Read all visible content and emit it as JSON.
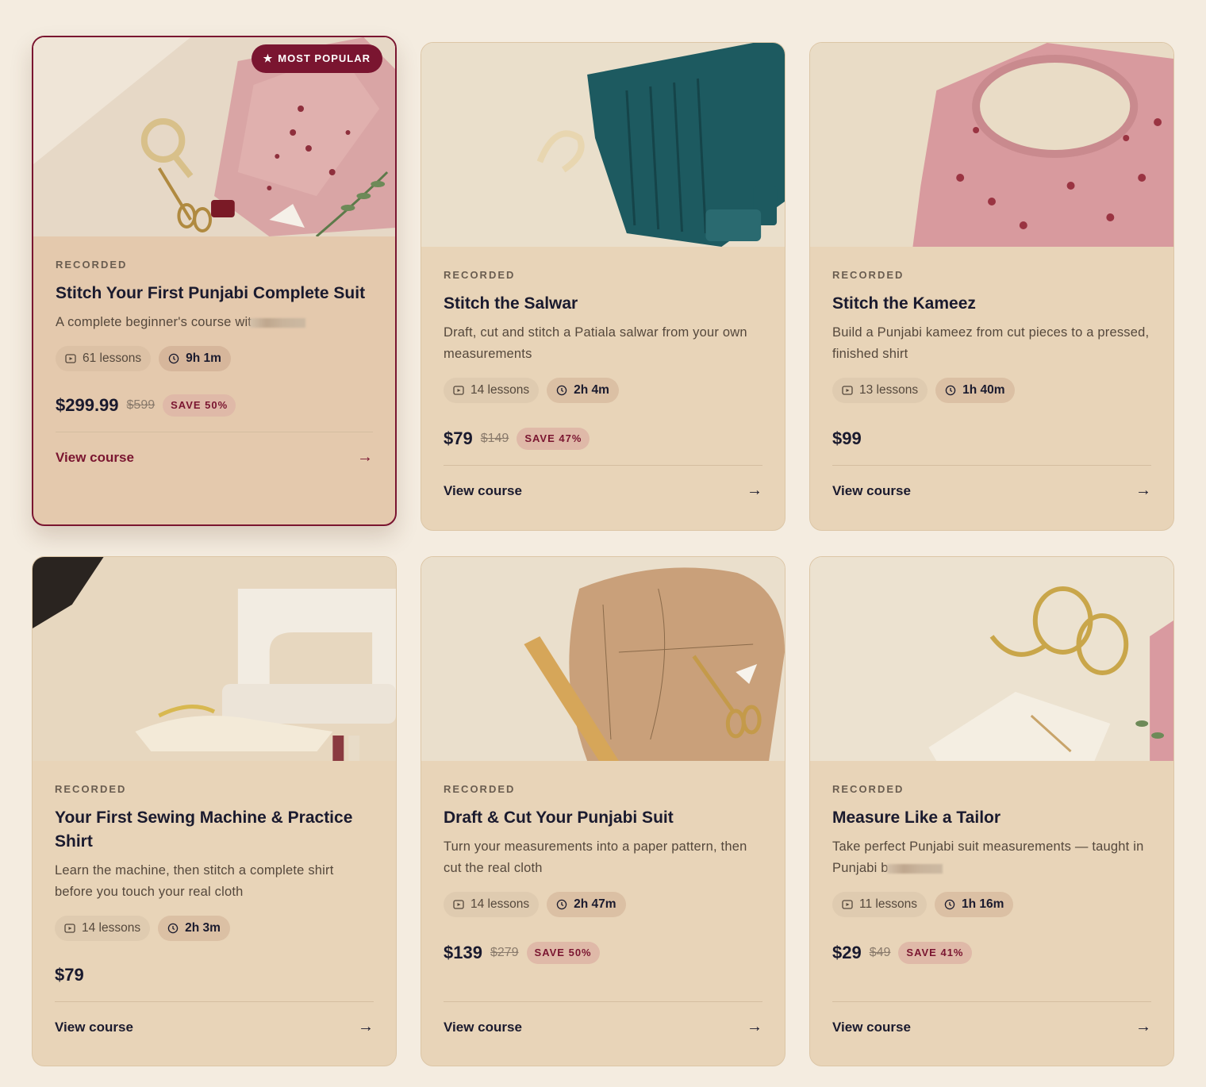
{
  "popular_badge": "MOST POPULAR",
  "colors": {
    "accent": "#7a1530",
    "card_bg": "#e8d4b8",
    "page_bg": "#f4ece0"
  },
  "courses": [
    {
      "kicker": "RECORDED",
      "title": "Stitch Your First Punjabi Complete Suit",
      "description": "A complete beginner's course wit",
      "lessons": "61 lessons",
      "duration": "9h 1m",
      "price": "$299.99",
      "original_price": "$599",
      "save": "SAVE 50%",
      "cta": "View course",
      "arrow": "→"
    },
    {
      "kicker": "RECORDED",
      "title": "Stitch the Salwar",
      "description": "Draft, cut and stitch a Patiala salwar from your own measurements",
      "lessons": "14 lessons",
      "duration": "2h 4m",
      "price": "$79",
      "original_price": "$149",
      "save": "SAVE 47%",
      "cta": "View course",
      "arrow": "→"
    },
    {
      "kicker": "RECORDED",
      "title": "Stitch the Kameez",
      "description": "Build a Punjabi kameez from cut pieces to a pressed, finished shirt",
      "lessons": "13 lessons",
      "duration": "1h 40m",
      "price": "$99",
      "cta": "View course",
      "arrow": "→"
    },
    {
      "kicker": "RECORDED",
      "title": "Your First Sewing Machine & Practice Shirt",
      "description": "Learn the machine, then stitch a complete shirt before you touch your real cloth",
      "lessons": "14 lessons",
      "duration": "2h 3m",
      "price": "$79",
      "cta": "View course",
      "arrow": "→"
    },
    {
      "kicker": "RECORDED",
      "title": "Draft & Cut Your Punjabi Suit",
      "description": "Turn your measurements into a paper pattern, then cut the real cloth",
      "lessons": "14 lessons",
      "duration": "2h 47m",
      "price": "$139",
      "original_price": "$279",
      "save": "SAVE 50%",
      "cta": "View course",
      "arrow": "→"
    },
    {
      "kicker": "RECORDED",
      "title": "Measure Like a Tailor",
      "description": "Take perfect Punjabi suit measurements — taught in Punjabi b",
      "lessons": "11 lessons",
      "duration": "1h 16m",
      "price": "$29",
      "original_price": "$49",
      "save": "SAVE 41%",
      "cta": "View course",
      "arrow": "→"
    }
  ]
}
